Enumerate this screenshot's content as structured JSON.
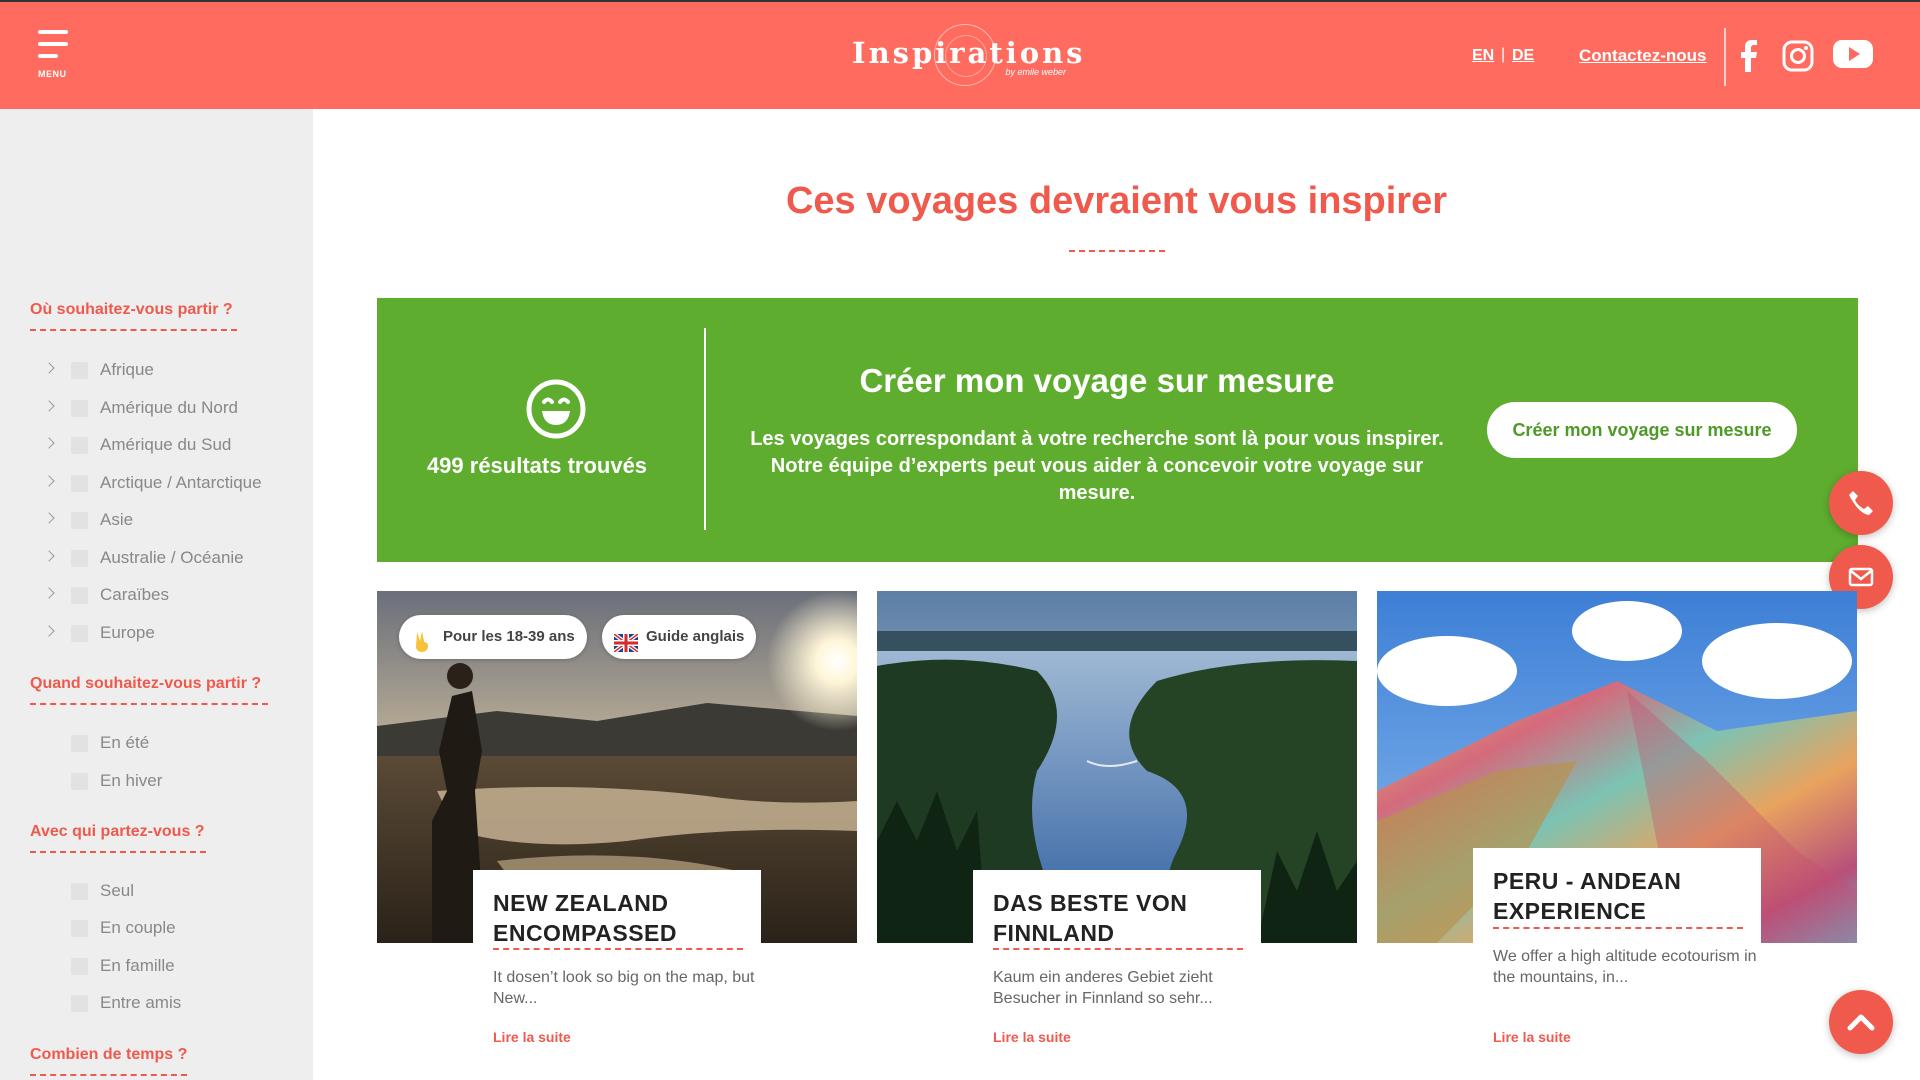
{
  "header": {
    "menu_label": "MENU",
    "logo_text": "Inspirations",
    "logo_sub": "by emile weber",
    "lang_en": "EN",
    "lang_sep": "|",
    "lang_de": "DE",
    "contact_label": "Contactez-nous",
    "social": [
      "facebook-icon",
      "instagram-icon",
      "youtube-icon"
    ]
  },
  "sidebar": {
    "sections": [
      {
        "title": "Où souhaitez-vous partir ?",
        "items": [
          "Afrique",
          "Amérique du Nord",
          "Amérique du Sud",
          "Arctique / Antarctique",
          "Asie",
          "Australie / Océanie",
          "Caraïbes",
          "Europe"
        ]
      },
      {
        "title": "Quand souhaitez-vous partir ?",
        "items": [
          "En été",
          "En hiver"
        ]
      },
      {
        "title": "Avec qui partez-vous ?",
        "items": [
          "Seul",
          "En couple",
          "En famille",
          "Entre amis"
        ]
      },
      {
        "title": "Combien de temps ?",
        "items": []
      }
    ]
  },
  "main": {
    "title": "Ces voyages devraient vous inspirer",
    "banner": {
      "results": "499 résultats trouvés",
      "title": "Créer mon voyage sur mesure",
      "text": "Les voyages correspondant à votre recherche sont là pour vous inspirer. Notre équipe d’experts peut vous aider à concevoir votre voyage sur mesure.",
      "button": "Créer mon voyage sur mesure"
    },
    "cards": [
      {
        "title_line1": "NEW ZEALAND",
        "title_line2": "ENCOMPASSED",
        "desc": "It dosen’t look so big on the map, but New...",
        "link": "Lire la suite",
        "tags": [
          "Pour les 18-39 ans",
          "Guide anglais"
        ]
      },
      {
        "title_line1": "DAS BESTE VON",
        "title_line2": "FINNLAND",
        "desc": "Kaum ein anderes Gebiet zieht Besucher in Finnland so sehr...",
        "link": "Lire la suite"
      },
      {
        "title_line1": "PERU - ANDEAN",
        "title_line2": "EXPERIENCE",
        "desc": "We offer a high altitude ecotourism in the mountains, in...",
        "link": "Lire la suite"
      }
    ]
  },
  "floating": [
    "phone-icon",
    "mail-icon",
    "chevron-up-icon"
  ],
  "colors": {
    "brand": "#ff6b5e",
    "accent": "#ef5a4d",
    "banner": "#5ead2f",
    "sidebar_bg": "#eeeeee"
  }
}
